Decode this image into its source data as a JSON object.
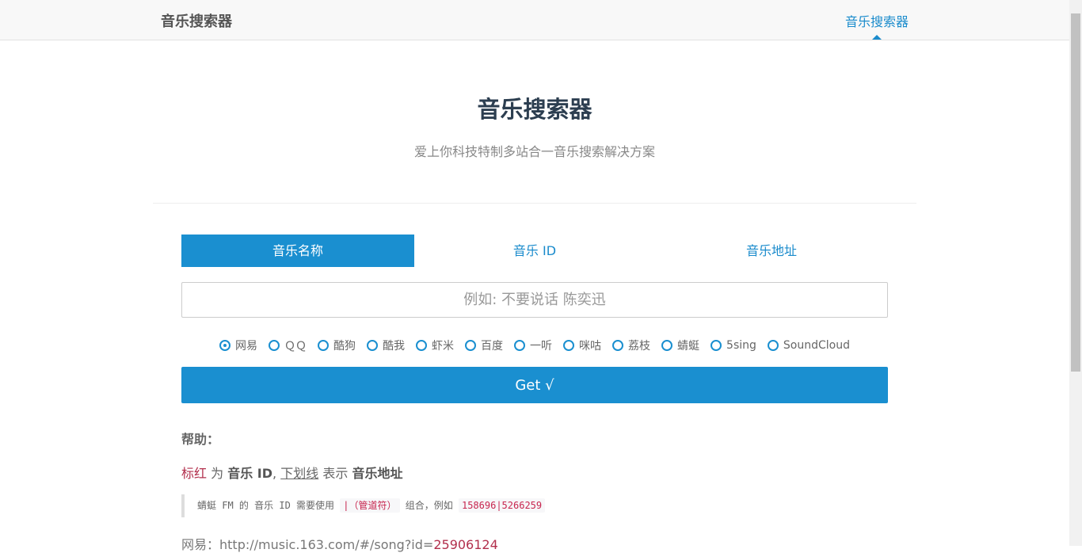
{
  "navbar": {
    "brand": "音乐搜索器",
    "link": "音乐搜索器"
  },
  "hero": {
    "title": "音乐搜索器",
    "subtitle": "爱上你科技特制多站合一音乐搜索解决方案"
  },
  "tabs": [
    {
      "label": "音乐名称",
      "active": true
    },
    {
      "label": "音乐 ID",
      "active": false
    },
    {
      "label": "音乐地址",
      "active": false
    }
  ],
  "search": {
    "placeholder": "例如: 不要说话 陈奕迅",
    "value": ""
  },
  "sources": [
    {
      "label": "网易",
      "checked": true
    },
    {
      "label": "ＱＱ",
      "checked": false
    },
    {
      "label": "酷狗",
      "checked": false
    },
    {
      "label": "酷我",
      "checked": false
    },
    {
      "label": "虾米",
      "checked": false
    },
    {
      "label": "百度",
      "checked": false
    },
    {
      "label": "一听",
      "checked": false
    },
    {
      "label": "咪咕",
      "checked": false
    },
    {
      "label": "荔枝",
      "checked": false
    },
    {
      "label": "蜻蜓",
      "checked": false
    },
    {
      "label": "5sing",
      "checked": false
    },
    {
      "label": "SoundCloud",
      "checked": false
    }
  ],
  "get_button": "Get √",
  "help": {
    "title": "帮助：",
    "red_text": "标红",
    "word_for": "为",
    "music_id": "音乐 ID",
    "comma": ",",
    "underline_text": "下划线",
    "word_means": "表示",
    "music_url": "音乐地址",
    "quote_prefix": "蜻蜓 FM 的 音乐 ID 需要使用",
    "quote_pipe": "|（管道符）",
    "quote_mid": "组合，例如",
    "quote_example": "158696|5266259",
    "example_prefix": "网易：http://music.163.com/#/song?id=",
    "example_id": "25906124"
  },
  "colors": {
    "accent": "#1a8fd0",
    "red": "#b22f4c"
  }
}
